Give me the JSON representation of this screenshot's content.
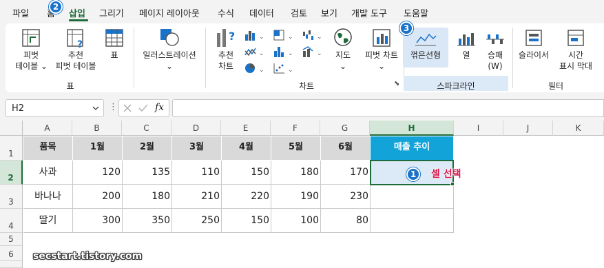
{
  "menu": {
    "tabs": [
      "파일",
      "홈",
      "삽입",
      "그리기",
      "페이지 레이아웃",
      "수식",
      "데이터",
      "검토",
      "보기",
      "개발 도구",
      "도움말"
    ],
    "active_tab": "삽입"
  },
  "callouts": {
    "step1": "1",
    "step2": "2",
    "step3": "3"
  },
  "ribbon": {
    "pivot_table": {
      "line1": "피벗",
      "line2": "테이블"
    },
    "recommended_pivot": {
      "line1": "추천",
      "line2": "피벗 테이블"
    },
    "table": "표",
    "illustrations": "일러스트레이션",
    "recommended_charts": {
      "line1": "추천",
      "line2": "차트"
    },
    "maps": "지도",
    "pivot_chart": "피벗 차트",
    "sparkline_line": "꺾은선형",
    "sparkline_column": "열",
    "sparkline_winloss": {
      "line1": "승패",
      "line2": "(W)"
    },
    "slicer": "슬라이서",
    "timeline": {
      "line1": "시간",
      "line2": "표시 막대"
    },
    "groups": {
      "tables": "표",
      "charts": "차트",
      "sparklines": "스파크라인",
      "filters": "필터"
    }
  },
  "formula_bar": {
    "name_box": "H2",
    "fx": "fx",
    "formula": ""
  },
  "sheet": {
    "columns": [
      "A",
      "B",
      "C",
      "D",
      "E",
      "F",
      "G",
      "H",
      "I",
      "J",
      "K"
    ],
    "selected_column": "H",
    "rows": [
      "1",
      "2",
      "3",
      "4",
      "5",
      "6"
    ],
    "selected_row": "2",
    "headers": [
      "품목",
      "1월",
      "2월",
      "3월",
      "4월",
      "5월",
      "6월",
      "매출 추이"
    ],
    "data": [
      {
        "item": "사과",
        "values": [
          "120",
          "135",
          "110",
          "150",
          "180",
          "170"
        ]
      },
      {
        "item": "바나나",
        "values": [
          "200",
          "180",
          "210",
          "220",
          "190",
          "230"
        ]
      },
      {
        "item": "딸기",
        "values": [
          "300",
          "350",
          "250",
          "150",
          "100",
          "80"
        ]
      }
    ]
  },
  "annotation": "셀 선택",
  "watermark": "secstart.tistory.com",
  "colors": {
    "accent": "#1e6b3a",
    "header_blue": "#12a3d9",
    "callout": "#1a73c9",
    "annotation": "#d6184f"
  }
}
